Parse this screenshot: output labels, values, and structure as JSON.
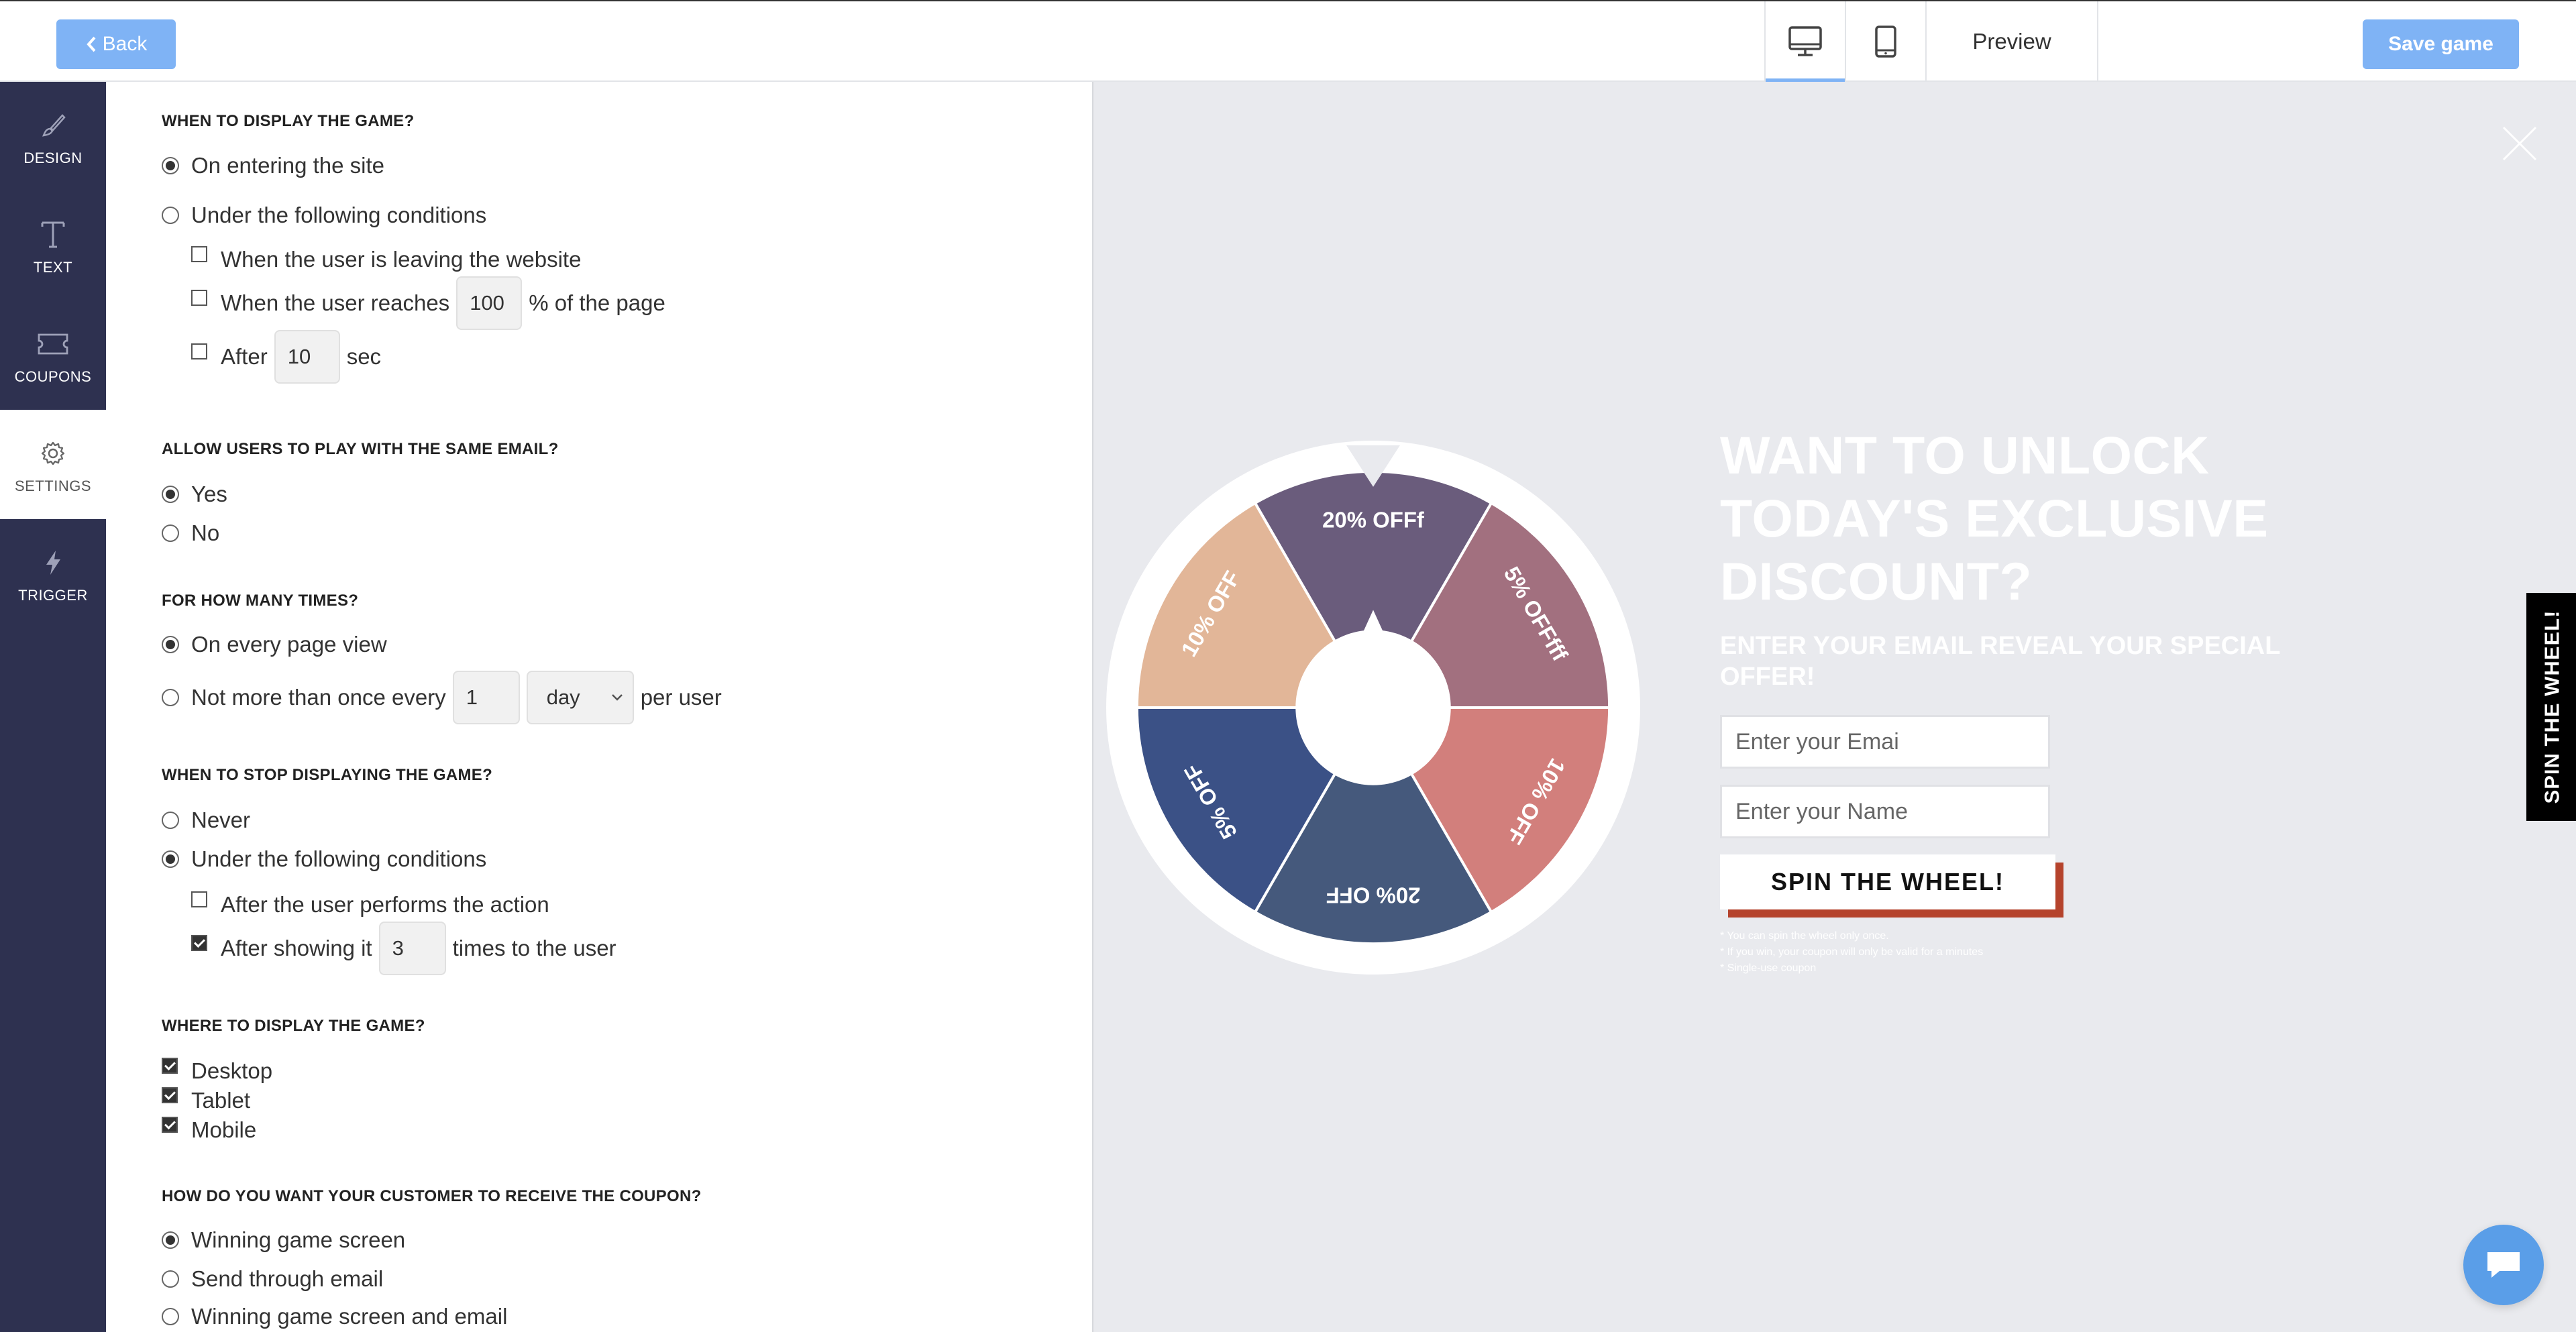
{
  "topbar": {
    "back_label": "Back",
    "preview_label": "Preview",
    "save_label": "Save game",
    "device_tabs": [
      {
        "name": "desktop-icon",
        "active": true
      },
      {
        "name": "tablet-icon",
        "active": false
      }
    ]
  },
  "sidebar": {
    "items": [
      {
        "label": "DESIGN",
        "icon": "brush-icon",
        "active": false
      },
      {
        "label": "TEXT",
        "icon": "text-icon",
        "active": false
      },
      {
        "label": "COUPONS",
        "icon": "ticket-icon",
        "active": false
      },
      {
        "label": "SETTINGS",
        "icon": "gear-icon",
        "active": true
      },
      {
        "label": "TRIGGER",
        "icon": "bolt-icon",
        "active": false
      }
    ]
  },
  "settings": {
    "display": {
      "title": "WHEN TO DISPLAY THE GAME?",
      "opt_entering": "On entering the site",
      "opt_conditions": "Under the following conditions",
      "cond_leaving": "When the user is leaving the website",
      "cond_reaches_pre": "When the user reaches",
      "cond_reaches_value": "100",
      "cond_reaches_post": "% of the page",
      "cond_after_pre": "After",
      "cond_after_value": "10",
      "cond_after_post": "sec"
    },
    "same_email": {
      "title": "ALLOW USERS TO PLAY WITH THE SAME EMAIL?",
      "yes": "Yes",
      "no": "No"
    },
    "times": {
      "title": "FOR HOW MANY TIMES?",
      "every_view": "On every page view",
      "not_more_pre": "Not more than once every",
      "not_more_value": "1",
      "unit": "day",
      "not_more_post": "per user"
    },
    "stop": {
      "title": "WHEN TO STOP DISPLAYING THE GAME?",
      "never": "Never",
      "conditions": "Under the following conditions",
      "after_action": "After the user performs the action",
      "after_showing_pre": "After showing it",
      "after_showing_value": "3",
      "after_showing_post": "times to the user"
    },
    "where": {
      "title": "WHERE TO DISPLAY THE GAME?",
      "desktop": "Desktop",
      "tablet": "Tablet",
      "mobile": "Mobile"
    },
    "coupon": {
      "title": "HOW DO YOU WANT YOUR CUSTOMER TO RECEIVE THE COUPON?",
      "screen": "Winning game screen",
      "email": "Send through email",
      "both": "Winning game screen and email"
    }
  },
  "preview": {
    "headline": "WANT TO UNLOCK TODAY'S EXCLUSIVE DISCOUNT?",
    "subheadline": "ENTER YOUR EMAIL REVEAL YOUR SPECIAL OFFER!",
    "email_placeholder": "Enter your Emai",
    "name_placeholder": "Enter your Name",
    "spin_label": "SPIN THE WHEEL!",
    "side_tab_label": "SPIN THE WHEEL!",
    "notes": [
      "* You can spin the wheel only once.",
      "* If you win, your coupon will only be valid for a minutes",
      "* Single-use coupon"
    ],
    "wheel": {
      "segments": [
        {
          "label": "20% OFFf",
          "color": "#6a5c7c"
        },
        {
          "label": "5% OFFfff",
          "color": "#a2707f"
        },
        {
          "label": "10% OFF",
          "color": "#d27f7c"
        },
        {
          "label": "20% OFF",
          "color": "#45597c"
        },
        {
          "label": "5% OFF",
          "color": "#3b5186"
        },
        {
          "label": "10% OFF",
          "color": "#e2b698"
        }
      ]
    }
  }
}
